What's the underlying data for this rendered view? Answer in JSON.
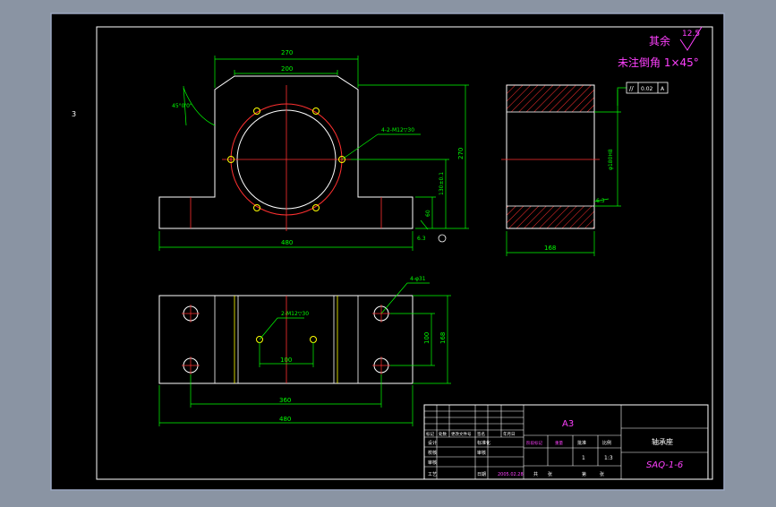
{
  "page_marker": "3",
  "surface_note": {
    "line1": "其余",
    "line2": "未注倒角 1×45°",
    "roughness": "12.5"
  },
  "front_view": {
    "dim_top_outer": "270",
    "dim_top_inner": "200",
    "dim_angle": "45°0'0\"",
    "dim_height": "270",
    "dim_center_height": "130±0.1",
    "dim_base": "60",
    "dim_width": "480",
    "callout_holes": "4-2-M12▽30",
    "roughness_base": "6.3"
  },
  "side_view": {
    "dim_bore": "φ180H8",
    "dim_width": "168",
    "roughness": "6.3",
    "tolerance_symbol": "//",
    "tolerance_value": "0.02",
    "tolerance_datum": "A"
  },
  "top_view": {
    "callout_holes": "2-M12▽30",
    "callout_bolt": "4-φ31",
    "dim_inner": "100",
    "dim_hole_spacing": "360",
    "dim_width": "480",
    "dim_rows": "100",
    "dim_depth": "168"
  },
  "title_block": {
    "format": "A3",
    "part_name": "轴承座",
    "drawing_no": "SAQ-1-6",
    "scale": "1:3",
    "sheet_count": "1",
    "rev_headers": [
      "标记",
      "处数",
      "更改文件号",
      "签名",
      "年月日"
    ],
    "role_design": "设计",
    "role_standard": "标准化",
    "role_check": "校核",
    "role_process_review": "工艺",
    "role_audit": "审核",
    "role_approve": "批准",
    "role_approval": "审核",
    "date_label": "日期",
    "date_value": "2005.02.28",
    "stage_label": "阶段标记",
    "weight_label": "重量",
    "scale_label": "比例",
    "total_label": "共",
    "sheet_label": "张",
    "page_label": "第"
  },
  "colors": {
    "canvas": "#000000",
    "outline": "#ffffff",
    "dimension": "#00ff00",
    "centerline": "#ff3030",
    "hole_yellow": "#ffff00",
    "text_magenta": "#ff40ff",
    "frame": "#9aa6c0"
  }
}
